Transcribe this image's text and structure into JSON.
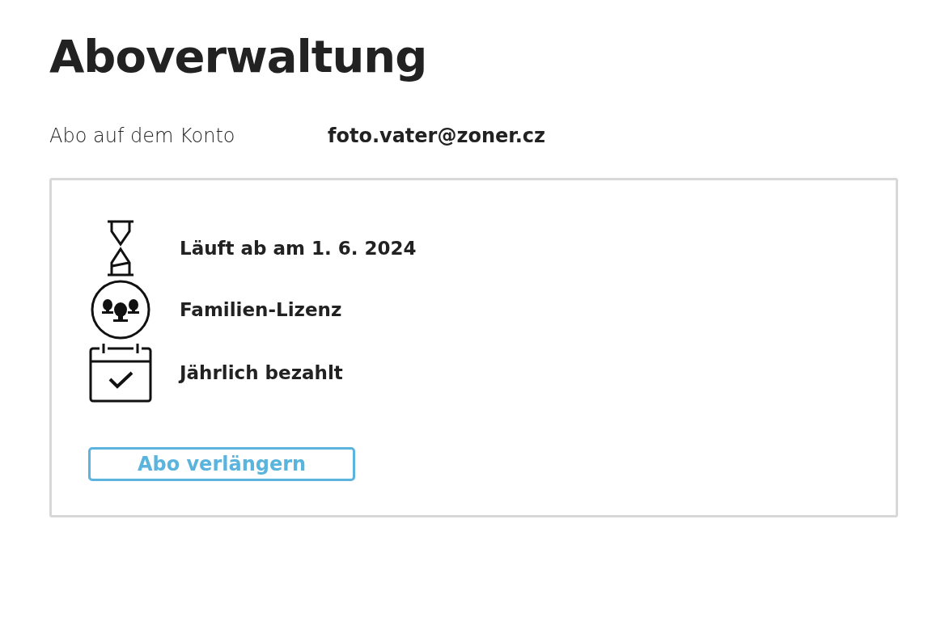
{
  "title": "Aboverwaltung",
  "account": {
    "label": "Abo auf dem Konto",
    "value": "foto.vater@zoner.cz"
  },
  "details": [
    {
      "kind": "expiry",
      "text": "Läuft ab am 1. 6. 2024"
    },
    {
      "kind": "license",
      "text": "Familien-Lizenz"
    },
    {
      "kind": "billing",
      "text": "Jährlich bezahlt"
    }
  ],
  "button": "Abo verlängern"
}
